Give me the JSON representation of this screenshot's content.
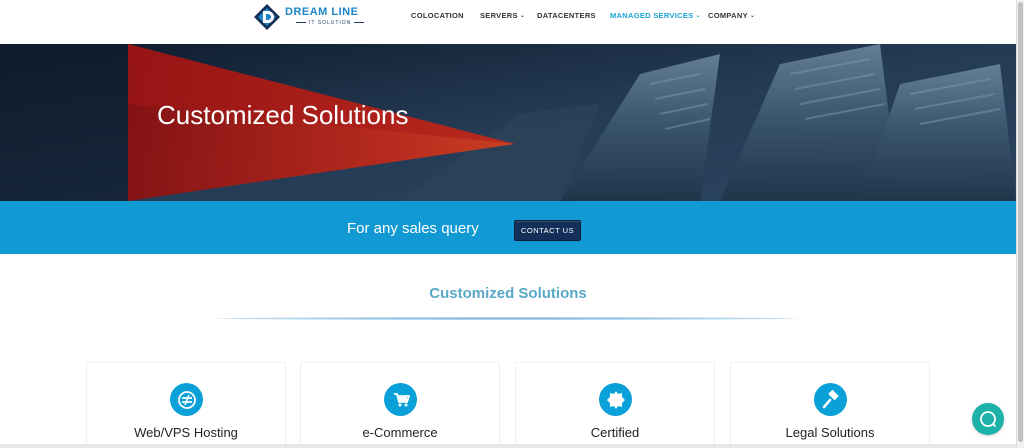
{
  "brand": {
    "name": "DREAM LINE",
    "tagline": "IT SOLUTION",
    "colors": {
      "primary": "#1d86c9",
      "accent": "#1aa2d4",
      "dark": "#14305a",
      "strip": "#1199d3"
    }
  },
  "nav": {
    "items": [
      {
        "label": "COLOCATION",
        "dropdown": false,
        "active": false
      },
      {
        "label": "SERVERS",
        "dropdown": true,
        "active": false
      },
      {
        "label": "DATACENTERS",
        "dropdown": false,
        "active": false
      },
      {
        "label": "MANAGED SERVICES",
        "dropdown": true,
        "active": true
      },
      {
        "label": "COMPANY",
        "dropdown": true,
        "active": false
      }
    ]
  },
  "hero": {
    "title": "Customized Solutions"
  },
  "cta": {
    "text": "For any sales query",
    "button": "CONTACT US"
  },
  "section": {
    "title": "Customized Solutions"
  },
  "cards": [
    {
      "label": "Web/VPS Hosting",
      "icon": "hosting-icon"
    },
    {
      "label": "e-Commerce",
      "icon": "cart-icon"
    },
    {
      "label": "Certified",
      "icon": "certified-badge-icon"
    },
    {
      "label": "Legal Solutions",
      "icon": "gavel-icon"
    }
  ]
}
